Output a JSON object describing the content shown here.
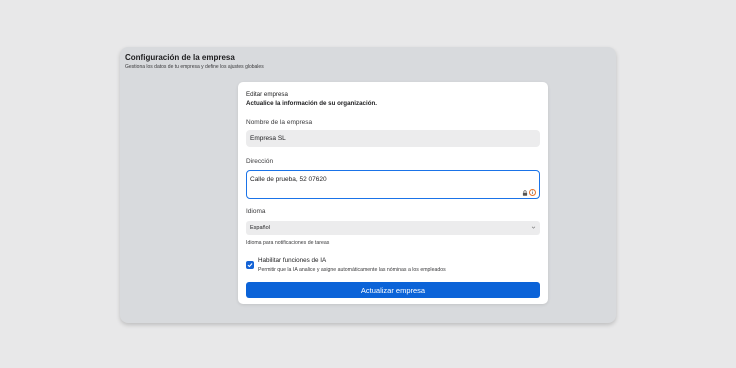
{
  "page": {
    "title": "Configuración de la empresa",
    "subtitle": "Gestiona los datos de tu empresa y define los ajustes globales"
  },
  "card": {
    "title": "Editar empresa",
    "subtitle": "Actualice la información de su organización."
  },
  "fields": {
    "company_name_label": "Nombre de la empresa",
    "company_name_value": "Empresa SL",
    "address_label": "Dirección",
    "address_value": "Calle de prueba, 52 07620",
    "language_label": "Idioma",
    "language_value": "Español",
    "language_help": "Idioma para notificaciones de tareas"
  },
  "ai": {
    "checked": true,
    "label": "Habilitar funciones de IA",
    "help": "Permitir que la IA analice y asigne automáticamente las nóminas a los empleados"
  },
  "actions": {
    "submit_label": "Actualizar empresa"
  },
  "colors": {
    "accent": "#0b63d8",
    "focus_border": "#1a73e8",
    "panel": "#d8dadd",
    "background": "#e8e8e9"
  },
  "icons": [
    "lock-icon",
    "info-icon",
    "chevron-down-icon",
    "checkmark-icon"
  ]
}
